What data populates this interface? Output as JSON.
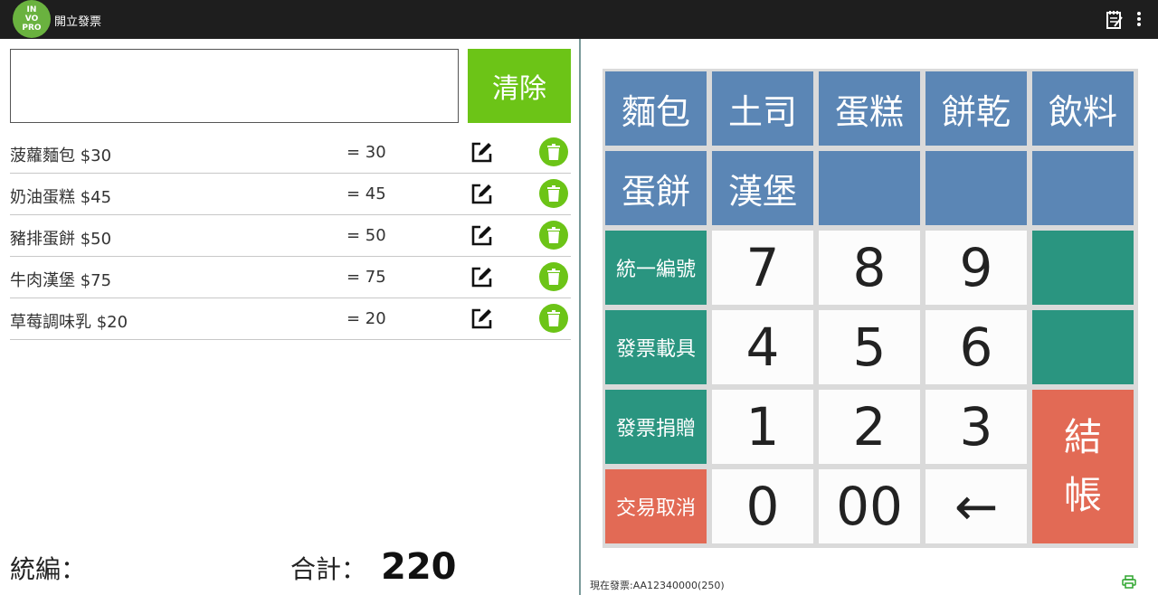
{
  "app": {
    "logo_text": "IN VO PRO",
    "title": "開立發票"
  },
  "input": {
    "value": ""
  },
  "clear_label": "清除",
  "items": [
    {
      "name": "菠蘿麵包 $30",
      "subtotal": "= 30"
    },
    {
      "name": "奶油蛋糕 $45",
      "subtotal": "= 45"
    },
    {
      "name": "豬排蛋餅 $50",
      "subtotal": "= 50"
    },
    {
      "name": "牛肉漢堡 $75",
      "subtotal": "= 75"
    },
    {
      "name": "草莓調味乳 $20",
      "subtotal": "= 20"
    }
  ],
  "footer": {
    "tax_id_label": "統編：",
    "total_label": "合計：",
    "total_value": "220"
  },
  "categories": [
    "麵包",
    "土司",
    "蛋糕",
    "餅乾",
    "飲料",
    "蛋餅",
    "漢堡"
  ],
  "function_keys": {
    "tax_id": "統一編號",
    "carrier": "發票載具",
    "donate": "發票捐贈",
    "cancel": "交易取消",
    "checkout_line1": "結",
    "checkout_line2": "帳"
  },
  "numpad": {
    "k7": "7",
    "k8": "8",
    "k9": "9",
    "k4": "4",
    "k5": "5",
    "k6": "6",
    "k1": "1",
    "k2": "2",
    "k3": "3",
    "k0": "0",
    "k00": "00",
    "backspace": "←"
  },
  "status": {
    "invoice": "現在發票:AA12340000(250)"
  },
  "colors": {
    "category": "#5b86b5",
    "teal": "#2a9580",
    "red": "#e26a55",
    "green": "#6cc417"
  }
}
